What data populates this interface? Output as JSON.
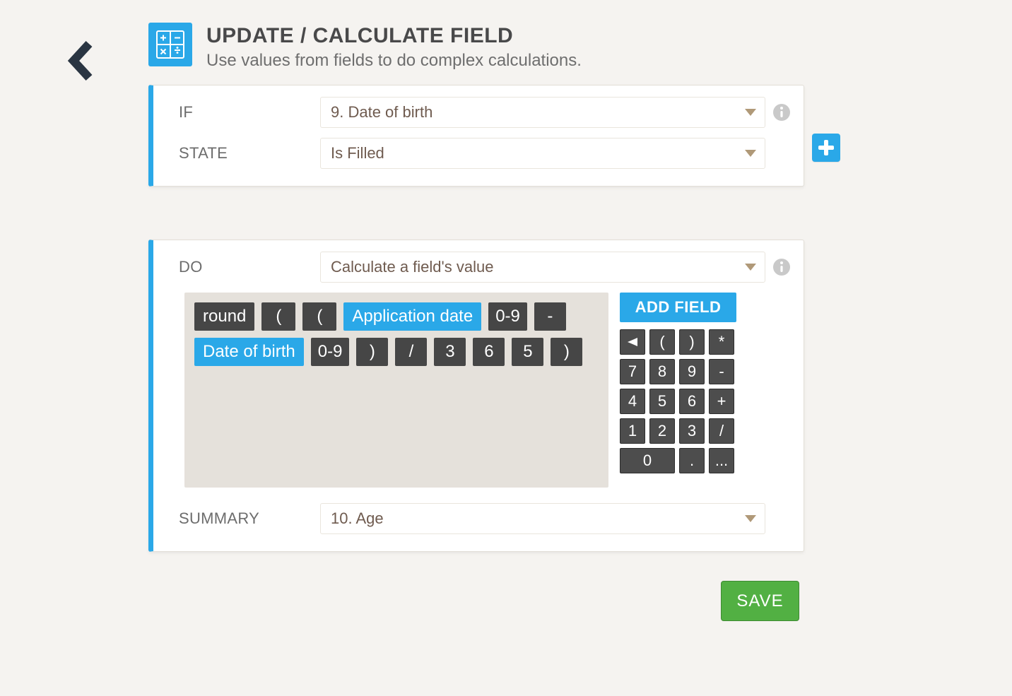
{
  "header": {
    "title": "UPDATE / CALCULATE FIELD",
    "subtitle": "Use values from fields to do complex calculations."
  },
  "if_card": {
    "if_label": "IF",
    "state_label": "STATE",
    "if_select": "9. Date of birth",
    "state_select": "Is Filled"
  },
  "do_card": {
    "do_label": "DO",
    "do_select": "Calculate a field's value",
    "add_field_label": "ADD FIELD",
    "summary_label": "SUMMARY",
    "summary_select": "10. Age",
    "tokens": {
      "t0": "round",
      "t1": "(",
      "t2": "(",
      "t3": "Application date",
      "t4": "0-9",
      "t5": "-",
      "t6": "Date of birth",
      "t7": "0-9",
      "t8": ")",
      "t9": "/",
      "t10": "3",
      "t11": "6",
      "t12": "5",
      "t13": ")"
    },
    "keys": {
      "k0": "(",
      "k1": ")",
      "k2": "*",
      "k3": "7",
      "k4": "8",
      "k5": "9",
      "k6": "-",
      "k7": "4",
      "k8": "5",
      "k9": "6",
      "k10": "+",
      "k11": "1",
      "k12": "2",
      "k13": "3",
      "k14": "/",
      "k15": "0",
      "k16": ".",
      "k17": "..."
    }
  },
  "save_label": "SAVE"
}
